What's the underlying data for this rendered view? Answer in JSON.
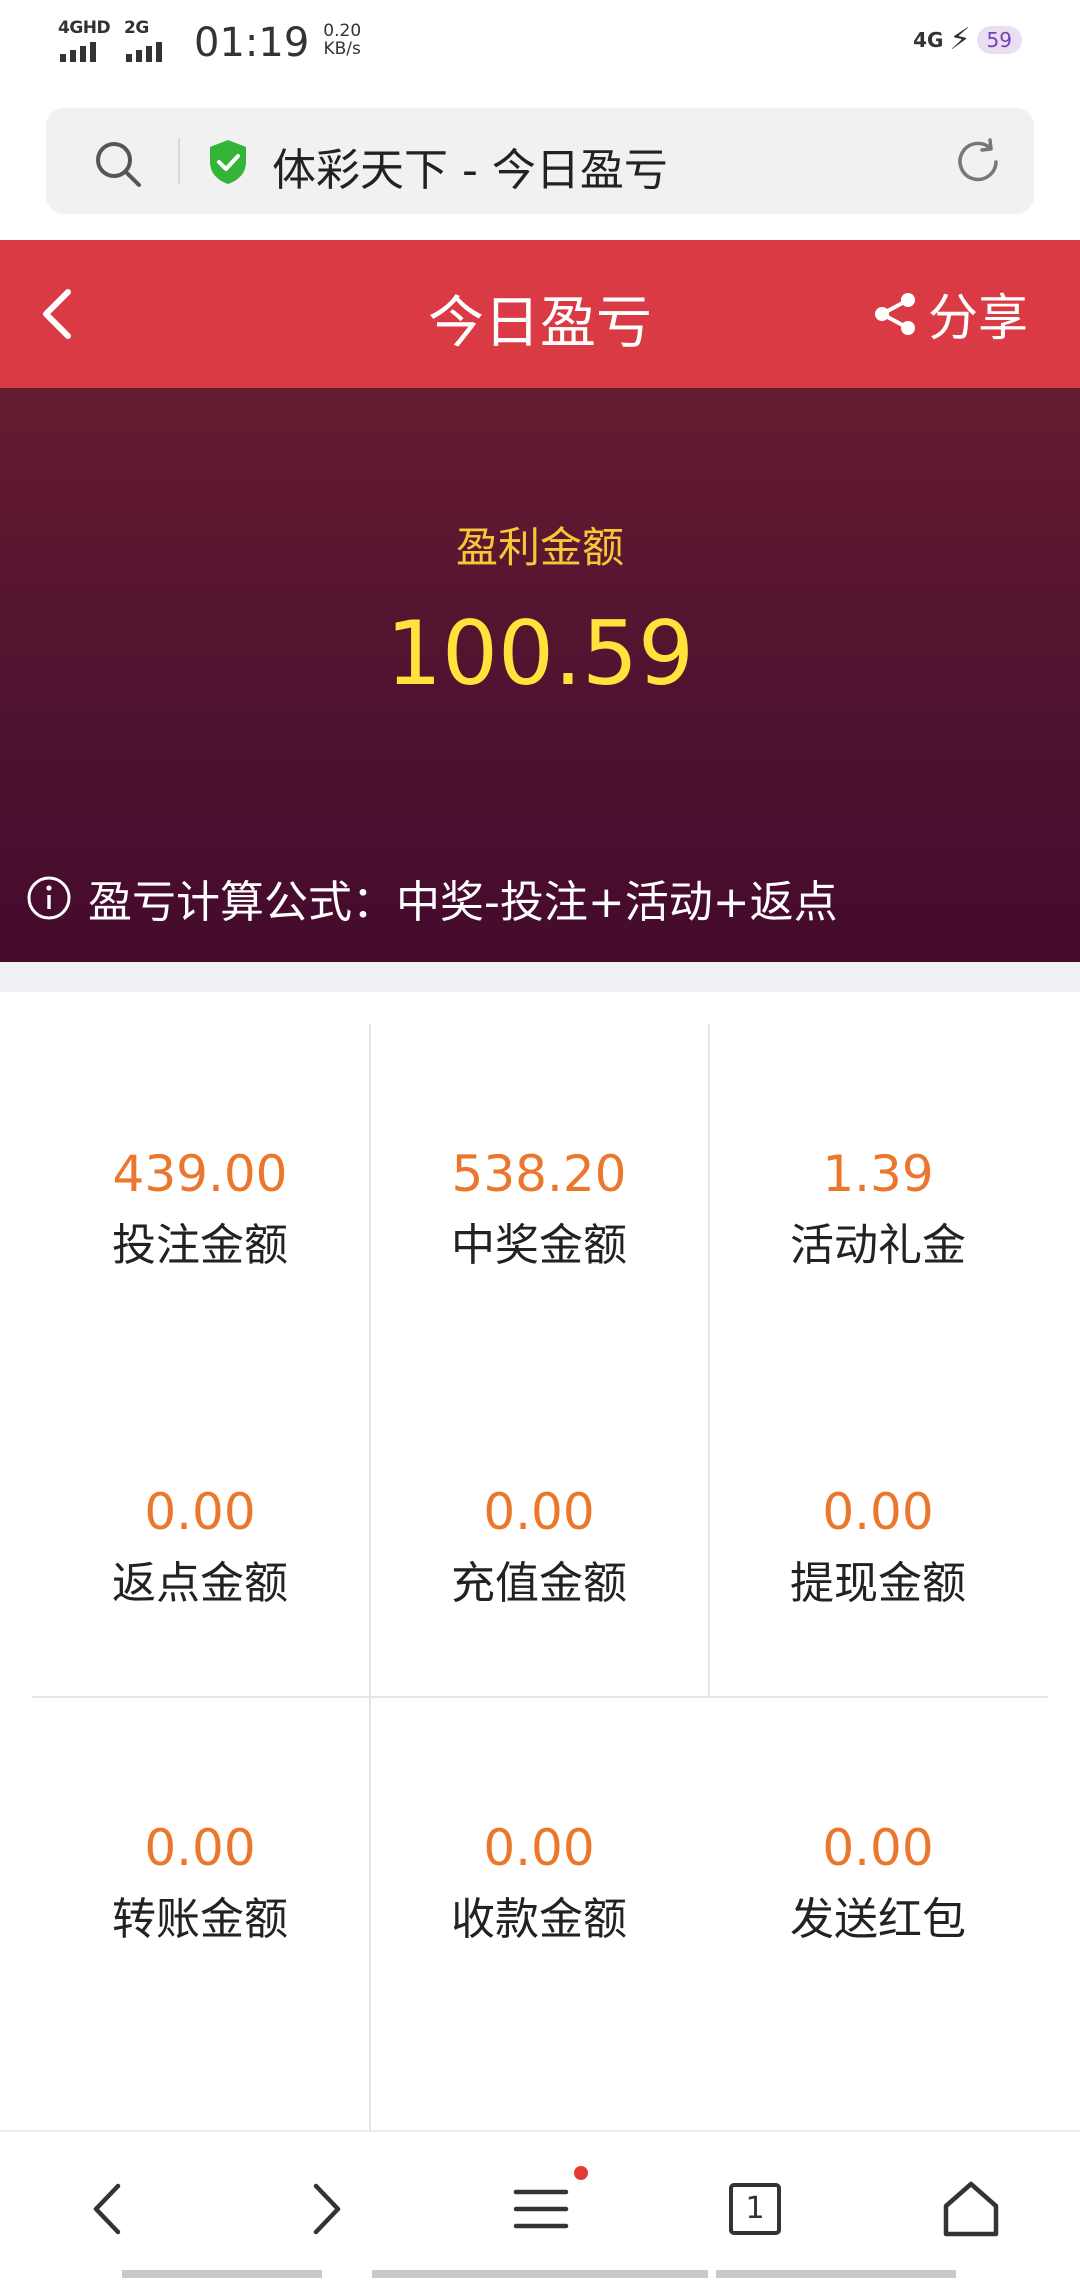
{
  "status_bar": {
    "network_1": "4GHD",
    "network_2": "2G",
    "time": "01:19",
    "speed_value": "0.20",
    "speed_unit": "KB/s",
    "network_right": "4G",
    "battery": "59"
  },
  "browser": {
    "url_title": "体彩天下 - 今日盈亏"
  },
  "header": {
    "title": "今日盈亏",
    "share_label": "分享"
  },
  "hero": {
    "profit_label": "盈利金额",
    "profit_amount": "100.59",
    "formula": "盈亏计算公式：中奖-投注+活动+返点"
  },
  "stats": [
    {
      "value": "439.00",
      "label": "投注金额"
    },
    {
      "value": "538.20",
      "label": "中奖金额"
    },
    {
      "value": "1.39",
      "label": "活动礼金"
    },
    {
      "value": "0.00",
      "label": "返点金额"
    },
    {
      "value": "0.00",
      "label": "充值金额"
    },
    {
      "value": "0.00",
      "label": "提现金额"
    },
    {
      "value": "0.00",
      "label": "转账金额"
    },
    {
      "value": "0.00",
      "label": "收款金额"
    },
    {
      "value": "0.00",
      "label": "发送红包"
    }
  ],
  "bottom_nav": {
    "tab_count": "1"
  },
  "colors": {
    "header_red": "#da3a43",
    "hero_top": "#651c30",
    "hero_bottom": "#450b2c",
    "profit_yellow": "#ffe23b",
    "stat_orange": "#ea772c"
  }
}
